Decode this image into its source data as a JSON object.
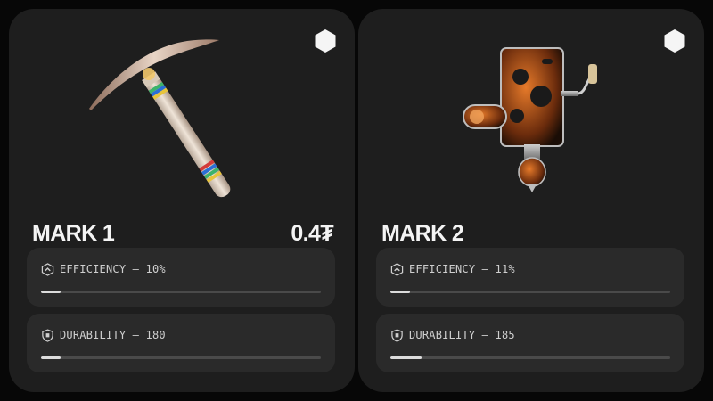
{
  "cards": [
    {
      "name": "MARK 1",
      "price": "0.4₮",
      "icon": "pickaxe",
      "stats": [
        {
          "label": "EFFICIENCY — 10%",
          "icon": "arrow-up-badge-icon",
          "level": 0.07
        },
        {
          "label": "DURABILITY — 180",
          "icon": "shield-icon",
          "level": 0.07
        }
      ]
    },
    {
      "name": "MARK 2",
      "price": "",
      "icon": "drill-machine",
      "stats": [
        {
          "label": "EFFICIENCY — 11%",
          "icon": "arrow-up-badge-icon",
          "level": 0.07
        },
        {
          "label": "DURABILITY — 185",
          "icon": "shield-icon",
          "level": 0.11
        }
      ]
    }
  ],
  "colors": {
    "background": "#070707",
    "card": "#1e1e1e",
    "panel": "#2a2a2a",
    "bar_fill": "#dcdcdc",
    "bar_track": "#4a4a4a"
  }
}
